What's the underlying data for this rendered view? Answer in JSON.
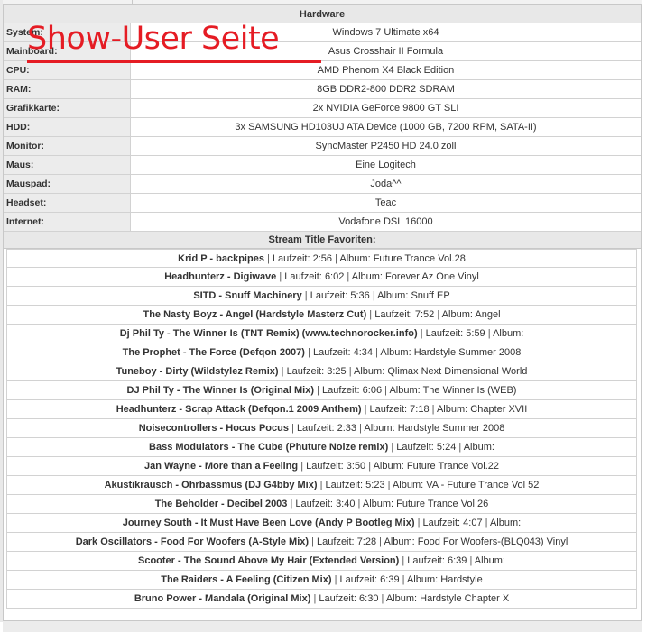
{
  "overlay": {
    "title": "Show-User Seite",
    "color": "#e51c24"
  },
  "hardware": {
    "header": "Hardware",
    "rows": [
      {
        "label": "System:",
        "value": "Windows 7 Ultimate x64"
      },
      {
        "label": "Mainboard:",
        "value": "Asus Crosshair II Formula"
      },
      {
        "label": "CPU:",
        "value": "AMD Phenom X4 Black Edition"
      },
      {
        "label": "RAM:",
        "value": "8GB DDR2-800 DDR2 SDRAM"
      },
      {
        "label": "Grafikkarte:",
        "value": "2x NVIDIA GeForce 9800 GT SLI"
      },
      {
        "label": "HDD:",
        "value": "3x SAMSUNG HD103UJ ATA Device (1000 GB, 7200 RPM, SATA-II)"
      },
      {
        "label": "Monitor:",
        "value": "SyncMaster P2450 HD 24.0 zoll"
      },
      {
        "label": "Maus:",
        "value": "Eine Logitech"
      },
      {
        "label": "Mauspad:",
        "value": "Joda^^"
      },
      {
        "label": "Headset:",
        "value": "Teac"
      },
      {
        "label": "Internet:",
        "value": "Vodafone DSL 16000"
      }
    ]
  },
  "stream": {
    "header": "Stream Title Favoriten:",
    "separator": "|",
    "duration_label": "Laufzeit:",
    "album_label": "Album:",
    "tracks": [
      {
        "title": "Krid P - backpipes",
        "duration": "2:56",
        "album": "Future Trance Vol.28"
      },
      {
        "title": "Headhunterz - Digiwave",
        "duration": "6:02",
        "album": "Forever Az One Vinyl"
      },
      {
        "title": "SITD - Snuff Machinery",
        "duration": "5:36",
        "album": "Snuff EP"
      },
      {
        "title": "The Nasty Boyz - Angel (Hardstyle Masterz Cut)",
        "duration": "7:52",
        "album": "Angel"
      },
      {
        "title": "Dj Phil Ty - The Winner Is (TNT Remix) (www.technorocker.info)",
        "duration": "5:59",
        "album": ""
      },
      {
        "title": "The Prophet - The Force (Defqon 2007)",
        "duration": "4:34",
        "album": "Hardstyle Summer 2008"
      },
      {
        "title": "Tuneboy - Dirty (Wildstylez Remix)",
        "duration": "3:25",
        "album": "Qlimax Next Dimensional World"
      },
      {
        "title": "DJ Phil Ty - The Winner Is (Original Mix)",
        "duration": "6:06",
        "album": "The Winner Is (WEB)"
      },
      {
        "title": "Headhunterz - Scrap Attack (Defqon.1 2009 Anthem)",
        "duration": "7:18",
        "album": "Chapter XVII"
      },
      {
        "title": "Noisecontrollers - Hocus Pocus",
        "duration": "2:33",
        "album": "Hardstyle Summer 2008"
      },
      {
        "title": "Bass Modulators - The Cube (Phuture Noize remix)",
        "duration": "5:24",
        "album": ""
      },
      {
        "title": "Jan Wayne - More than a Feeling",
        "duration": "3:50",
        "album": "Future Trance Vol.22"
      },
      {
        "title": "Akustikrausch - Ohrbassmus (DJ G4bby Mix)",
        "duration": "5:23",
        "album": "VA - Future Trance Vol 52"
      },
      {
        "title": "The Beholder - Decibel 2003",
        "duration": "3:40",
        "album": "Future Trance Vol 26"
      },
      {
        "title": "Journey South - It Must Have Been Love (Andy P Bootleg Mix)",
        "duration": "4:07",
        "album": ""
      },
      {
        "title": "Dark Oscillators - Food For Woofers (A-Style Mix)",
        "duration": "7:28",
        "album": "Food For Woofers-(BLQ043) Vinyl"
      },
      {
        "title": "Scooter - The Sound Above My Hair (Extended Version)",
        "duration": "6:39",
        "album": ""
      },
      {
        "title": "The Raiders - A Feeling (Citizen Mix)",
        "duration": "6:39",
        "album": "Hardstyle"
      },
      {
        "title": "Bruno Power - Mandala (Original Mix)",
        "duration": "6:30",
        "album": "Hardstyle Chapter X"
      }
    ]
  }
}
